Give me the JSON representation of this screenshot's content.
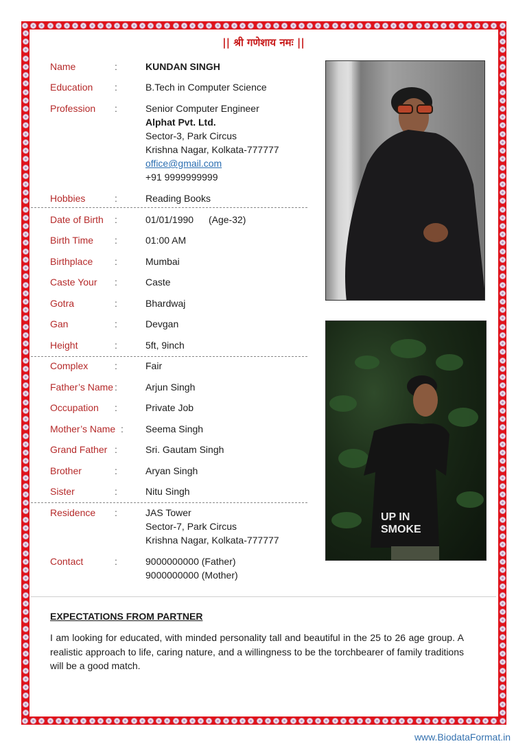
{
  "header": {
    "invocation": "|| श्री गणेशाय  नमः ||"
  },
  "colors": {
    "frame": "#e0141c",
    "label": "#b52a2a",
    "link": "#2c6fb2",
    "watermark": "#3572b0"
  },
  "profile": {
    "name": {
      "label": "Name",
      "value": "KUNDAN SINGH"
    },
    "education": {
      "label": "Education",
      "value": "B.Tech in Computer Science"
    },
    "profession": {
      "label": "Profession",
      "title": "Senior Computer Engineer",
      "company": "Alphat Pvt. Ltd.",
      "address1": "Sector-3, Park Circus",
      "address2": "Krishna Nagar, Kolkata-777777",
      "email": "office@gmail.com",
      "phone": "+91 9999999999"
    },
    "hobbies": {
      "label": "Hobbies",
      "value": "Reading Books"
    },
    "dob": {
      "label": "Date of Birth",
      "value": "01/01/1990",
      "age": "(Age-32)"
    },
    "birth_time": {
      "label": "Birth Time",
      "value": "01:00 AM"
    },
    "birthplace": {
      "label": "Birthplace",
      "value": "Mumbai"
    },
    "caste": {
      "label": "Caste Your",
      "value": "Caste"
    },
    "gotra": {
      "label": "Gotra",
      "value": "Bhardwaj"
    },
    "gan": {
      "label": "Gan",
      "value": "Devgan"
    },
    "height": {
      "label": "Height",
      "value": "5ft, 9inch"
    },
    "complex": {
      "label": "Complex",
      "value": "Fair"
    },
    "father": {
      "label": "Father’s Name",
      "value": "Arjun Singh"
    },
    "occupation": {
      "label": "Occupation",
      "value": "Private Job"
    },
    "mother": {
      "label": "Mother’s Name",
      "value": "Seema Singh"
    },
    "grandfather": {
      "label": "Grand Father",
      "value": "Sri. Gautam Singh"
    },
    "brother": {
      "label": "Brother",
      "value": "Aryan Singh"
    },
    "sister": {
      "label": "Sister",
      "value": "Nitu Singh"
    },
    "residence": {
      "label": "Residence",
      "line1": "JAS Tower",
      "line2": "Sector-7, Park Circus",
      "line3": "Krishna Nagar, Kolkata-777777"
    },
    "contact": {
      "label": "Contact",
      "line1": "9000000000 (Father)",
      "line2": "9000000000 (Mother)"
    }
  },
  "separator": ":",
  "photos": [
    {
      "alt": "Portrait photo in black jacket and orange sunglasses"
    },
    {
      "alt": "Photo in black t-shirt against green foliage",
      "shirt_text": "UP IN SMOKE"
    }
  ],
  "expectations": {
    "title": "EXPECTATIONS FROM PARTNER",
    "text": "I am looking for educated, with minded personality tall and beautiful in the 25 to 26 age group. A realistic approach to life, caring nature, and a willingness to be the torchbearer of family traditions will be a good match."
  },
  "watermark": "www.BiodataFormat.in"
}
